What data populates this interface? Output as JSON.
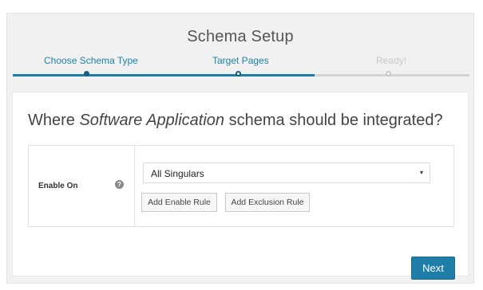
{
  "header": {
    "title": "Schema Setup"
  },
  "steps": [
    {
      "label": "Choose Schema Type",
      "state": "completed"
    },
    {
      "label": "Target Pages",
      "state": "current"
    },
    {
      "label": "Ready!",
      "state": "upcoming"
    }
  ],
  "progress": {
    "completed_fraction": 0.66
  },
  "main": {
    "question_prefix": "Where ",
    "question_schema": "Software Application",
    "question_suffix": " schema should be integrated?",
    "enable_on_label": "Enable On",
    "help_icon": "?",
    "select_value": "All Singulars",
    "select_caret": "▾",
    "add_enable_rule": "Add Enable Rule",
    "add_exclusion_rule": "Add Exclusion Rule",
    "next_label": "Next"
  },
  "colors": {
    "accent": "#1f7ea8",
    "inactive": "#c8c8c8"
  }
}
